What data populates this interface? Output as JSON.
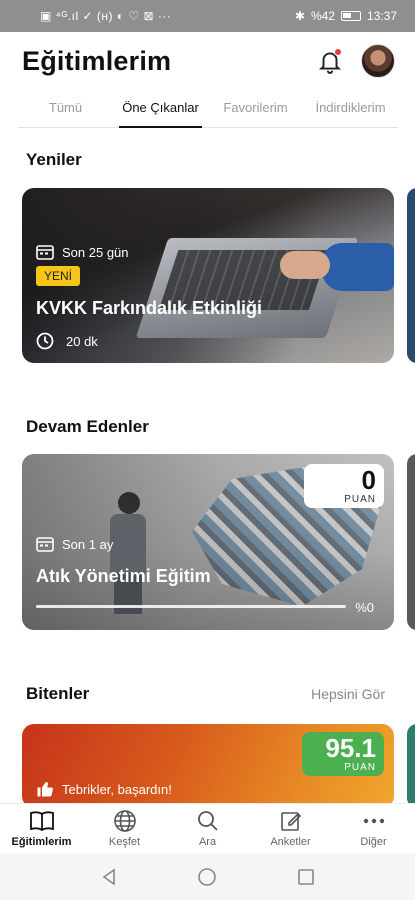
{
  "status_bar": {
    "left": "▣ ⁴ᴳ.ıl ✓ (ʜ) ◐ ♡ ⊠ ···",
    "right_bt": "✱",
    "battery_text": "%42",
    "time": "13:37"
  },
  "header": {
    "title": "Eğitimlerim"
  },
  "tabs": [
    {
      "label": "Tümü"
    },
    {
      "label": "Öne Çıkanlar"
    },
    {
      "label": "Favorilerim"
    },
    {
      "label": "İndirdiklerim"
    }
  ],
  "sections": {
    "new": {
      "title": "Yeniler",
      "card": {
        "date": "Son 25 gün",
        "badge": "YENİ",
        "title": "KVKK Farkındalık Etkinliği",
        "duration": "20 dk"
      }
    },
    "continuing": {
      "title": "Devam Edenler",
      "card": {
        "date": "Son 1 ay",
        "title": "Atık Yönetimi Eğitim",
        "score": "0",
        "score_label": "PUAN",
        "progress_value": 0,
        "progress_text": "%0"
      }
    },
    "finished": {
      "title": "Bitenler",
      "see_all": "Hepsini Gör",
      "card": {
        "score": "95.1",
        "score_label": "PUAN",
        "message": "Tebrikler, başardın!"
      }
    }
  },
  "bottom_nav": [
    {
      "label": "Eğitimlerim",
      "icon": "book-icon"
    },
    {
      "label": "Keşfet",
      "icon": "globe-icon"
    },
    {
      "label": "Ara",
      "icon": "search-icon"
    },
    {
      "label": "Anketler",
      "icon": "edit-icon"
    },
    {
      "label": "Diğer",
      "icon": "more-icon"
    }
  ],
  "colors": {
    "accent_blue": "#1e88e5",
    "badge_yellow": "#f5c518",
    "score_green": "#4caf50",
    "notification_red": "#e53935"
  }
}
